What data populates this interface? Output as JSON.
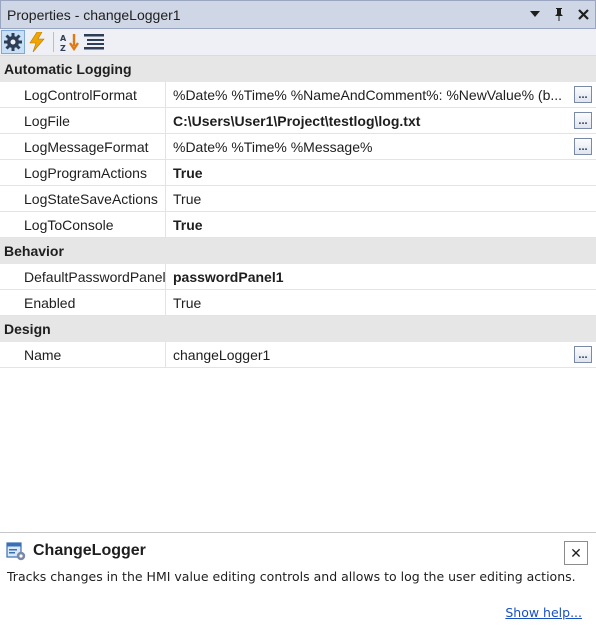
{
  "window": {
    "title": "Properties - changeLogger1",
    "buttons": [
      "▼",
      "📌",
      "✕"
    ]
  },
  "toolbar": {
    "icons": [
      "properties-icon",
      "events-icon",
      "alphabetical-sort-icon",
      "categorized-icon"
    ]
  },
  "grid": {
    "categories": [
      {
        "name": "Automatic Logging",
        "rows": [
          {
            "name": "LogControlFormat",
            "value": "%Date% %Time% %NameAndComment%: %NewValue% (b...",
            "bold": false,
            "button": true
          },
          {
            "name": "LogFile",
            "value": "C:\\Users\\User1\\Project\\testlog\\log.txt",
            "bold": true,
            "button": true
          },
          {
            "name": "LogMessageFormat",
            "value": "%Date% %Time% %Message%",
            "bold": false,
            "button": true
          },
          {
            "name": "LogProgramActions",
            "value": "True",
            "bold": true,
            "button": false
          },
          {
            "name": "LogStateSaveActions",
            "value": "True",
            "bold": false,
            "button": false
          },
          {
            "name": "LogToConsole",
            "value": "True",
            "bold": true,
            "button": false
          }
        ]
      },
      {
        "name": "Behavior",
        "rows": [
          {
            "name": "DefaultPasswordPanel",
            "value": "passwordPanel1",
            "bold": true,
            "button": false
          },
          {
            "name": "Enabled",
            "value": "True",
            "bold": false,
            "button": false
          }
        ]
      },
      {
        "name": "Design",
        "rows": [
          {
            "name": "Name",
            "value": "changeLogger1",
            "bold": false,
            "button": true
          }
        ]
      }
    ],
    "ellipsis_label": "..."
  },
  "description": {
    "title": "ChangeLogger",
    "text": "Tracks changes in the HMI value editing controls and allows to log the user editing actions.",
    "link": "Show help...",
    "close": "✕"
  },
  "colors": {
    "titlebar": "#cfd6e5",
    "category": "#e6e6e6",
    "link": "#1a4fc2"
  }
}
